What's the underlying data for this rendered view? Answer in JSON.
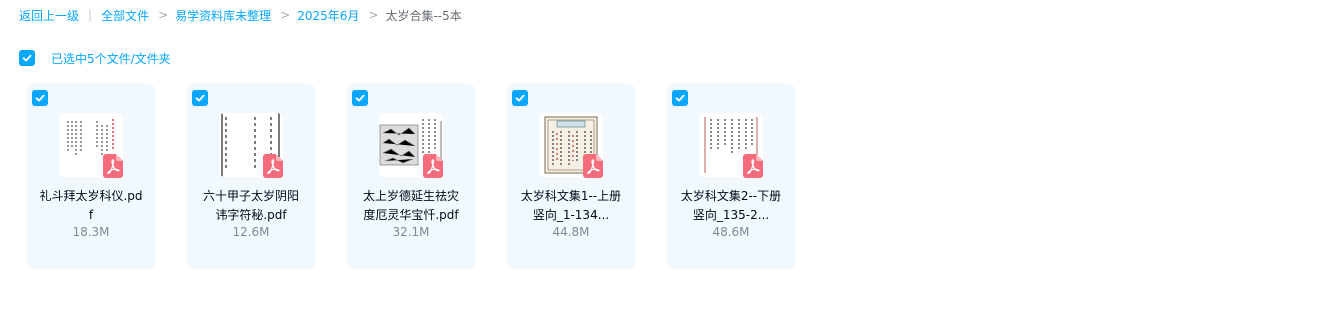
{
  "breadcrumb": {
    "back": "返回上一级",
    "all_files": "全部文件",
    "folder1": "易学资料库未整理",
    "folder2": "2025年6月",
    "current": "太岁合集--5本",
    "separator": "|",
    "chevron": ">"
  },
  "selection": {
    "label": "已选中5个文件/文件夹",
    "checked": true
  },
  "colors": {
    "accent": "#06a7ff",
    "card_bg": "#f2f9fe",
    "pdf_badge": "#f56c7a"
  },
  "files": [
    {
      "name_line1": "礼斗拜太岁科仪.pd",
      "name_line2": "f",
      "size": "18.3M",
      "icon": "pdf-icon",
      "checked": true
    },
    {
      "name_line1": "六十甲子太岁阴阳",
      "name_line2": "讳字符秘.pdf",
      "size": "12.6M",
      "icon": "pdf-icon",
      "checked": true
    },
    {
      "name_line1": "太上岁德延生祛灾",
      "name_line2": "度厄灵华宝忏.pdf",
      "size": "32.1M",
      "icon": "pdf-icon",
      "checked": true
    },
    {
      "name_line1": "太岁科文集1--上册",
      "name_line2": "竖向_1-134...",
      "size": "44.8M",
      "icon": "pdf-icon",
      "checked": true
    },
    {
      "name_line1": "太岁科文集2--下册",
      "name_line2": "竖向_135-2...",
      "size": "48.6M",
      "icon": "pdf-icon",
      "checked": true
    }
  ]
}
